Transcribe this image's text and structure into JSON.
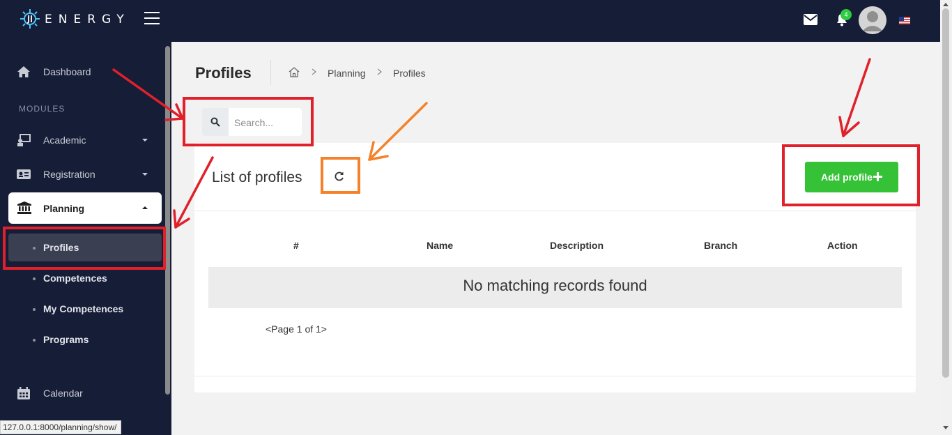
{
  "app": {
    "brand": "ENERGY"
  },
  "header": {
    "notification_count": "4"
  },
  "sidebar": {
    "dashboard": "Dashboard",
    "section_label": "MODULES",
    "academic": "Academic",
    "registration": "Registration",
    "planning": "Planning",
    "planning_items": [
      {
        "label": "Profiles"
      },
      {
        "label": "Competences"
      },
      {
        "label": "My Competences"
      },
      {
        "label": "Programs"
      }
    ],
    "calendar": "Calendar"
  },
  "page": {
    "title": "Profiles",
    "breadcrumb": [
      "Planning",
      "Profiles"
    ]
  },
  "search": {
    "placeholder": "Search..."
  },
  "card": {
    "title": "List of profiles",
    "add_label": "Add profile",
    "table": {
      "columns": [
        "#",
        "Name",
        "Description",
        "Branch",
        "Action"
      ],
      "rows": [],
      "empty_message": "No matching records found"
    },
    "pagination": "<Page 1 of 1>"
  },
  "status_url": "127.0.0.1:8000/planning/show/",
  "colors": {
    "sidebar_bg": "#161d37",
    "accent_green": "#35c236",
    "annotation_red": "#e0202a",
    "annotation_orange": "#f5822a"
  }
}
